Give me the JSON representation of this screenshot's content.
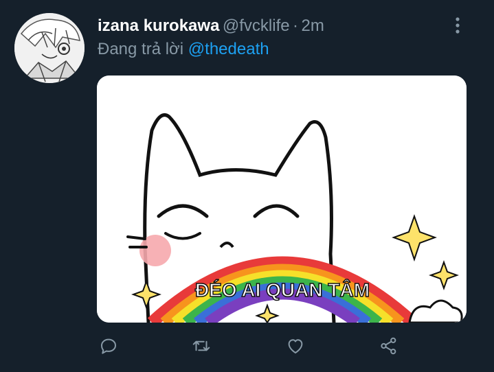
{
  "tweet": {
    "display_name": "izana kurokawa",
    "handle": "@fvcklife",
    "separator": "·",
    "time": "2m",
    "reply_prefix": "Đang trả lời ",
    "reply_to": "@thedeath",
    "image_caption": "ĐÉO AI QUAN TÂM"
  },
  "colors": {
    "background": "#15202b",
    "name": "#ffffff",
    "muted": "#8899a6",
    "mention": "#1da1f2"
  },
  "icons": {
    "reply": "reply-icon",
    "retweet": "retweet-icon",
    "like": "heart-icon",
    "share": "share-icon",
    "more": "more-vertical-icon"
  }
}
